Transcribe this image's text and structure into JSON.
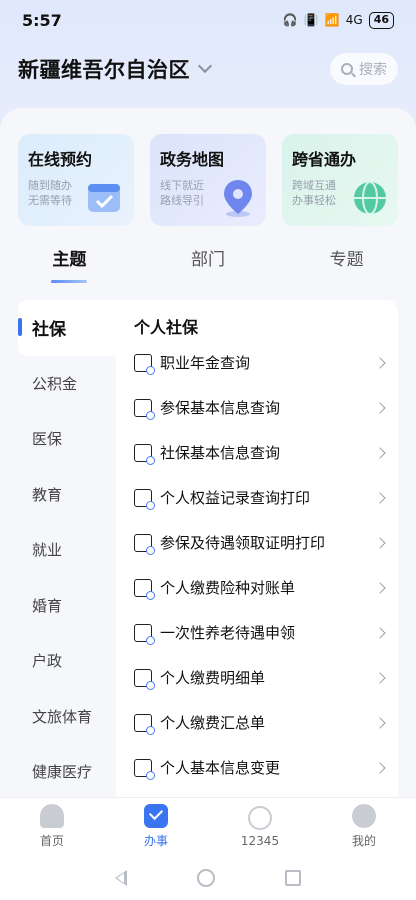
{
  "status_bar": {
    "time": "5:57",
    "network": "4G",
    "battery": "46"
  },
  "header": {
    "region": "新疆维吾尔自治区",
    "search_placeholder": "搜索"
  },
  "service_cards": [
    {
      "title": "在线预约",
      "subtitle_line1": "随到随办",
      "subtitle_line2": "无需等待",
      "icon": "calendar-check-icon"
    },
    {
      "title": "政务地图",
      "subtitle_line1": "线下就近",
      "subtitle_line2": "路线导引",
      "icon": "map-pin-icon"
    },
    {
      "title": "跨省通办",
      "subtitle_line1": "跨域互通",
      "subtitle_line2": "办事轻松",
      "icon": "globe-icon"
    }
  ],
  "tabs": [
    {
      "label": "主题",
      "active": true
    },
    {
      "label": "部门",
      "active": false
    },
    {
      "label": "专题",
      "active": false
    }
  ],
  "categories": [
    {
      "label": "社保",
      "active": true
    },
    {
      "label": "公积金"
    },
    {
      "label": "医保"
    },
    {
      "label": "教育"
    },
    {
      "label": "就业"
    },
    {
      "label": "婚育"
    },
    {
      "label": "户政"
    },
    {
      "label": "文旅体育"
    },
    {
      "label": "健康医疗"
    }
  ],
  "panel": {
    "title": "个人社保",
    "items": [
      {
        "label": "职业年金查询"
      },
      {
        "label": "参保基本信息查询"
      },
      {
        "label": "社保基本信息查询"
      },
      {
        "label": "个人权益记录查询打印"
      },
      {
        "label": "参保及待遇领取证明打印"
      },
      {
        "label": "个人缴费险种对账单"
      },
      {
        "label": "一次性养老待遇申领"
      },
      {
        "label": "个人缴费明细单"
      },
      {
        "label": "个人缴费汇总单"
      },
      {
        "label": "个人基本信息变更"
      }
    ]
  },
  "bottom_nav": [
    {
      "label": "首页",
      "icon": "home-icon"
    },
    {
      "label": "办事",
      "icon": "work-icon",
      "active": true
    },
    {
      "label": "12345",
      "icon": "hotline-icon"
    },
    {
      "label": "我的",
      "icon": "profile-icon"
    }
  ],
  "colors": {
    "accent": "#3a74f0",
    "background": "#f3f5f9"
  }
}
